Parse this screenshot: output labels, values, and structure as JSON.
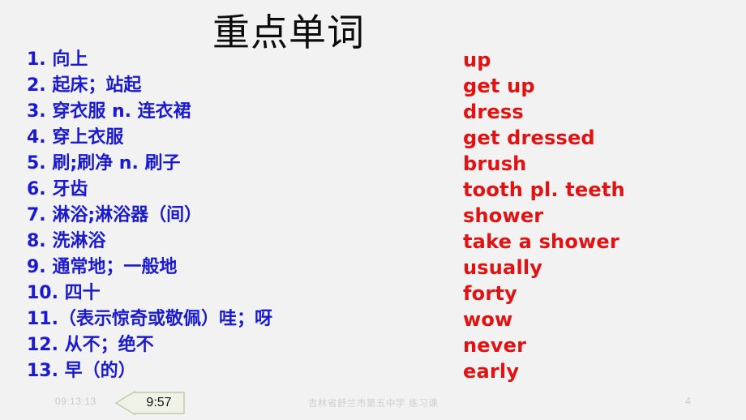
{
  "slide": {
    "title": "重点单词",
    "background_color": "#f2f2f2",
    "chinese_color": "#1a1ad0",
    "english_color": "#e21212",
    "title_color": "#0c0c0c"
  },
  "vocabulary": {
    "chinese": [
      "1. 向上",
      "2. 起床；站起",
      "3. 穿衣服  n. 连衣裙",
      "4. 穿上衣服",
      "5. 刷;刷净  n. 刷子",
      "6. 牙齿",
      "7. 淋浴;淋浴器（间）",
      "8. 洗淋浴",
      "9. 通常地；一般地",
      "10. 四十",
      "11.（表示惊奇或敬佩）哇；呀",
      "12. 从不；绝不",
      "13. 早（的）"
    ],
    "english": [
      "up",
      "get up",
      "dress",
      "get dressed",
      "brush",
      "tooth    pl. teeth",
      "shower",
      "take a shower",
      "usually",
      "forty",
      "wow",
      "never",
      "early"
    ]
  },
  "footer": {
    "timestamp": "09:13:13",
    "center_text": "吉林省舒兰市第五中学  练习课",
    "page_number": "4",
    "callout_time": "9:57"
  }
}
